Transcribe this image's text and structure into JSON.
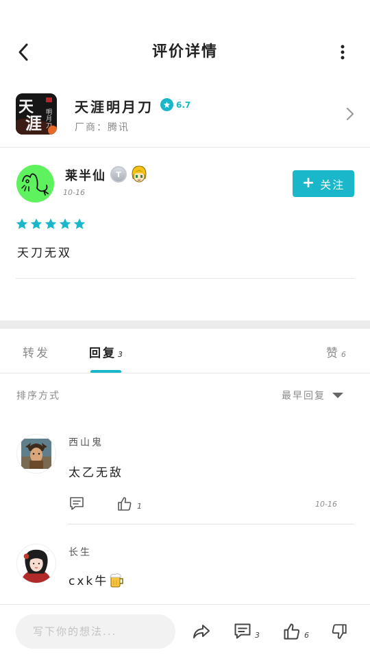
{
  "header": {
    "title": "评价详情"
  },
  "game": {
    "name": "天涯明月刀",
    "rating": "6.7",
    "maker_label": "厂商：",
    "maker": "腾讯",
    "icon_text": "天涯"
  },
  "review": {
    "user_name": "莱半仙",
    "badge_letter": "T",
    "date": "10-16",
    "follow_label": "关注",
    "stars": 5,
    "text": "天刀无双"
  },
  "tabs": {
    "repost": "转发",
    "reply": "回复",
    "reply_count": "3",
    "likes": "赞",
    "likes_count": "6"
  },
  "sort": {
    "label": "排序方式",
    "selected": "最早回复"
  },
  "comments": [
    {
      "name": "西山鬼",
      "text": "太乙无敌",
      "likes": "1",
      "date": "10-16"
    },
    {
      "name": "长生",
      "text": "cxk牛"
    }
  ],
  "bottom_bar": {
    "placeholder": "写下你的想法...",
    "reply_count": "3",
    "like_count": "6"
  },
  "colors": {
    "accent": "#19b7c9",
    "avatar_green": "#5ef25e",
    "band_gray": "#ececec"
  },
  "icons": [
    "back-arrow-icon",
    "more-vertical-icon",
    "chevron-right-icon",
    "star-icon",
    "plus-icon",
    "comment-icon",
    "thumbs-up-icon",
    "thumbs-down-icon",
    "share-arrow-icon",
    "beer-mug-icon",
    "caret-down-icon"
  ]
}
